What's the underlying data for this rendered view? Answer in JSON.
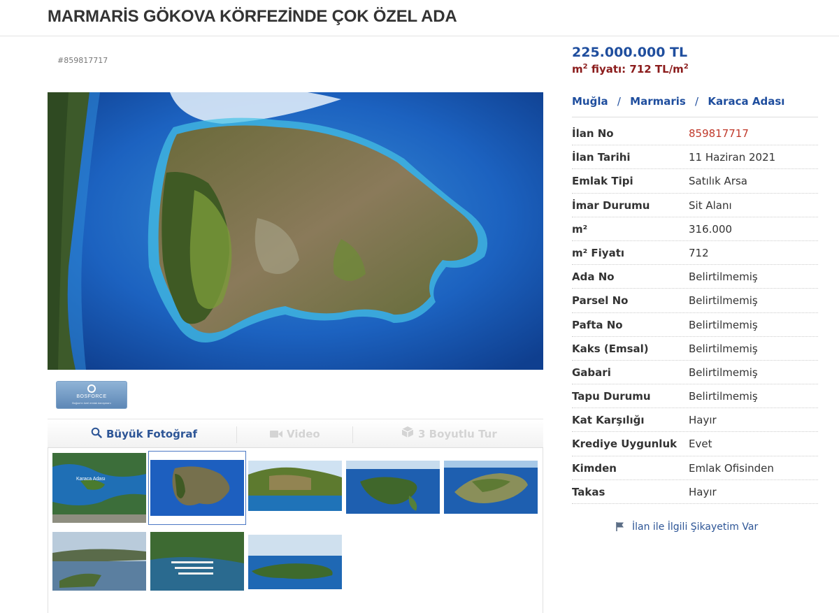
{
  "title": "MARMARİS GÖKOVA KÖRFEZİNDE ÇOK ÖZEL ADA",
  "listing_id_label": "#859817717",
  "price": "225.000.000 TL",
  "m2_price": {
    "prefix": "m",
    "sup": "2",
    "text": " fiyatı: 712 TL/m",
    "suffix_sup": "2"
  },
  "breadcrumb": [
    "Muğla",
    "Marmaris",
    "Karaca Adası"
  ],
  "breadcrumb_separator": "/",
  "media_tabs": {
    "photo": "Büyük Fotoğraf",
    "video": "Video",
    "tour": "3 Boyutlu Tur"
  },
  "logo": {
    "name": "BOSFORCE",
    "tagline": "Boğaz'ın özel emlak danışmanı"
  },
  "details": [
    {
      "label": "İlan No",
      "value": "859817717",
      "highlight": true
    },
    {
      "label": "İlan Tarihi",
      "value": "11 Haziran 2021"
    },
    {
      "label": "Emlak Tipi",
      "value": "Satılık Arsa"
    },
    {
      "label": "İmar Durumu",
      "value": "Sit Alanı"
    },
    {
      "label": "m²",
      "value": "316.000"
    },
    {
      "label": "m² Fiyatı",
      "value": "712"
    },
    {
      "label": "Ada No",
      "value": "Belirtilmemiş"
    },
    {
      "label": "Parsel No",
      "value": "Belirtilmemiş"
    },
    {
      "label": "Pafta No",
      "value": "Belirtilmemiş"
    },
    {
      "label": "Kaks (Emsal)",
      "value": "Belirtilmemiş"
    },
    {
      "label": "Gabari",
      "value": "Belirtilmemiş"
    },
    {
      "label": "Tapu Durumu",
      "value": "Belirtilmemiş"
    },
    {
      "label": "Kat Karşılığı",
      "value": "Hayır"
    },
    {
      "label": "Krediye Uygunluk",
      "value": "Evet"
    },
    {
      "label": "Kimden",
      "value": "Emlak Ofisinden"
    },
    {
      "label": "Takas",
      "value": "Hayır"
    }
  ],
  "complaint_link": "İlan ile İlgili Şikayetim Var",
  "thumb_map_label": "Karaca Adası",
  "colors": {
    "accent_blue": "#1f4e9e",
    "price_red": "#8b1c1c",
    "listing_no_red": "#c0392b",
    "sea": "#1a5fb8",
    "land_green": "#4e6b2e"
  },
  "icons": {
    "photo_tab": "search-icon",
    "video_tab": "video-camera-icon",
    "tour_tab": "cube-icon",
    "complaint": "flag-icon"
  }
}
